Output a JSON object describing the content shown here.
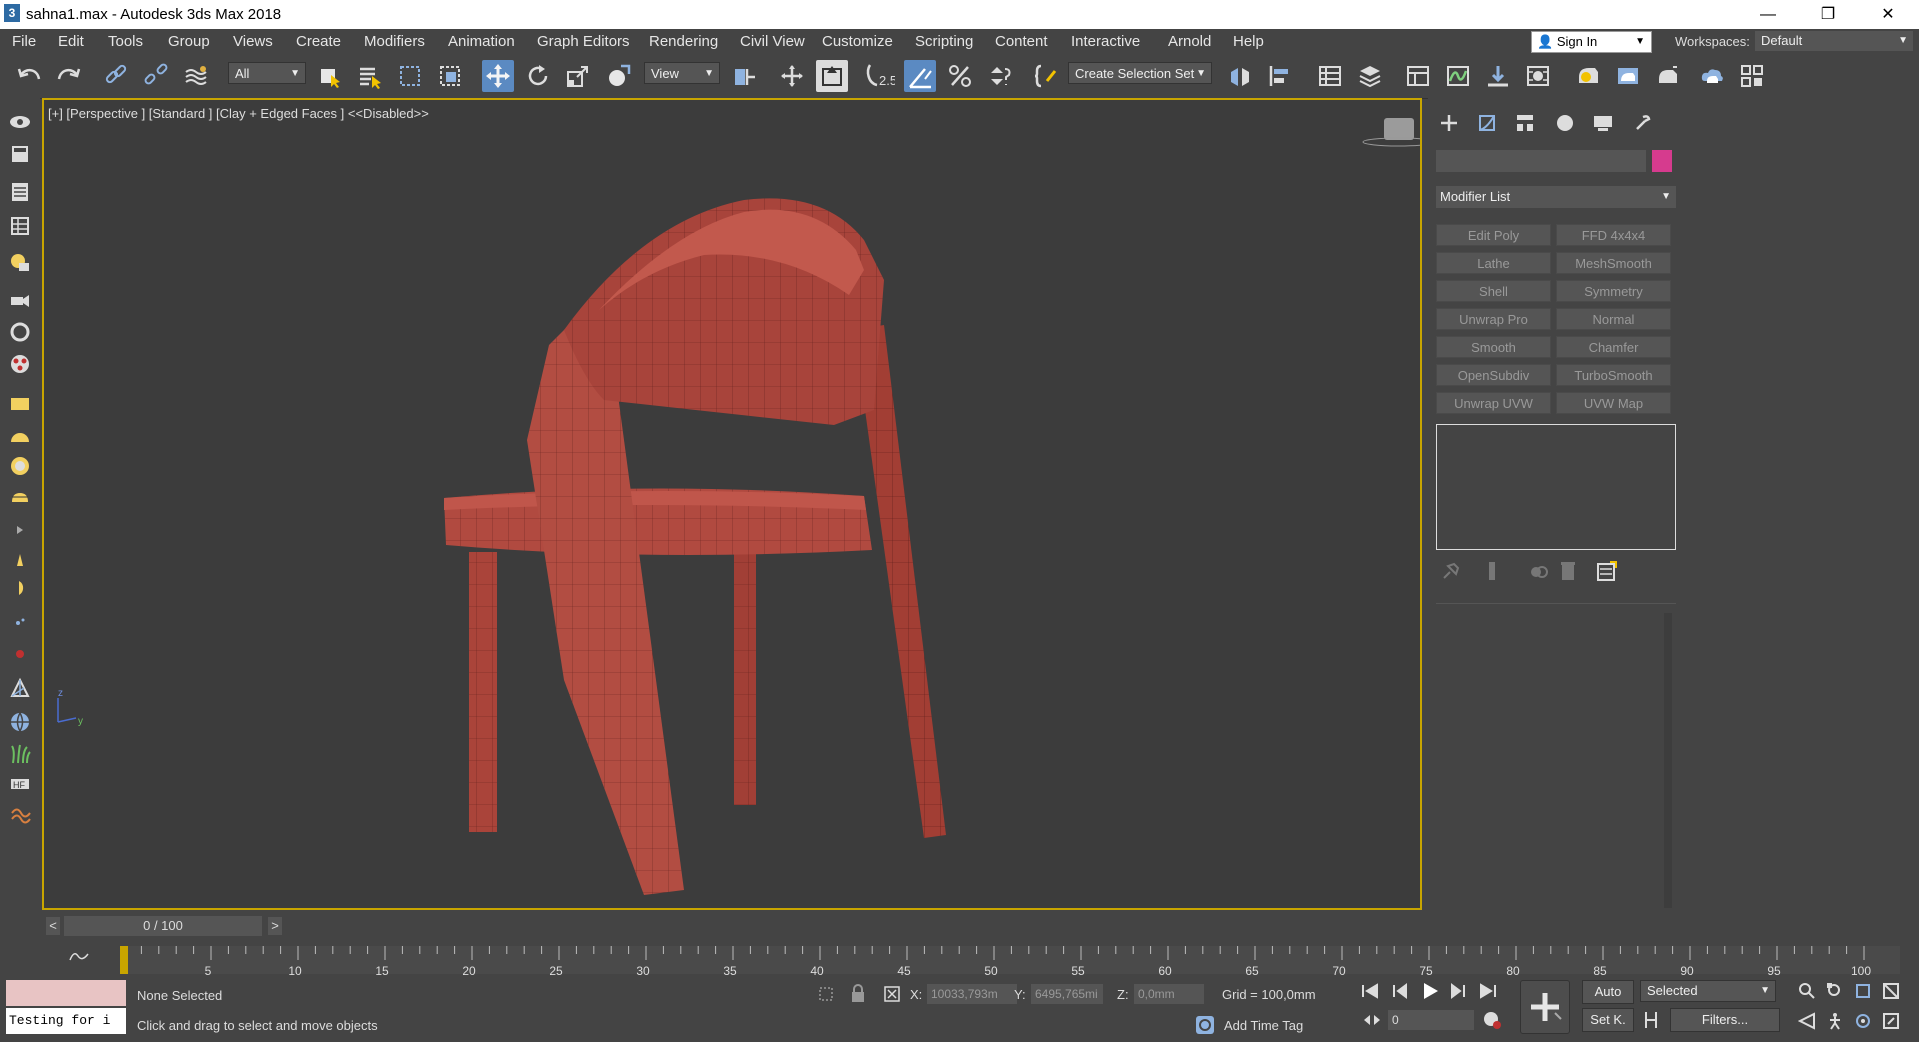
{
  "window": {
    "title": "sahna1.max - Autodesk 3ds Max 2018",
    "app_icon_glyph": "3",
    "minimize": "—",
    "restore": "❐",
    "close": "✕"
  },
  "menu": {
    "items": [
      "File",
      "Edit",
      "Tools",
      "Group",
      "Views",
      "Create",
      "Modifiers",
      "Animation",
      "Graph Editors",
      "Rendering",
      "Civil View",
      "Customize",
      "Scripting",
      "Content",
      "Interactive",
      "Arnold",
      "Help"
    ],
    "signin": "Sign In",
    "workspaces_label": "Workspaces:",
    "workspaces_value": "Default"
  },
  "toolbar": {
    "selection_filter": "All",
    "ref_coord": "View",
    "named_selection": "Create Selection Set",
    "snap_label": "2.5"
  },
  "viewport": {
    "label": "[+] [Perspective ] [Standard ] [Clay + Edged Faces ]  <<Disabled>>"
  },
  "command_panel": {
    "color": "#d63b8e",
    "modifier_list": "Modifier List",
    "modifiers": [
      "Edit Poly",
      "FFD 4x4x4",
      "Lathe",
      "MeshSmooth",
      "Shell",
      "Symmetry",
      "Unwrap Pro",
      "Normal",
      "Smooth",
      "Chamfer",
      "OpenSubdiv",
      "TurboSmooth",
      "Unwrap UVW",
      "UVW Map"
    ]
  },
  "timeline": {
    "frame": "0 / 100",
    "prev": "<",
    "next": ">",
    "ticks": [
      "5",
      "10",
      "15",
      "20",
      "25",
      "30",
      "35",
      "40",
      "45",
      "50",
      "55",
      "60",
      "65",
      "70",
      "75",
      "80",
      "85",
      "90",
      "95",
      "100"
    ]
  },
  "status": {
    "script_listener": "Testing for i",
    "selection": "None Selected",
    "prompt": "Click and drag to select and move objects",
    "x_label": "X:",
    "x_value": "10033,793m",
    "y_label": "Y:",
    "y_value": "6495,765mi",
    "z_label": "Z:",
    "z_value": "0,0mm",
    "grid": "Grid = 100,0mm",
    "add_time_tag": "Add Time Tag",
    "auto": "Auto",
    "selected": "Selected",
    "set_key": "Set K.",
    "filters": "Filters...",
    "frame_field": "0"
  }
}
